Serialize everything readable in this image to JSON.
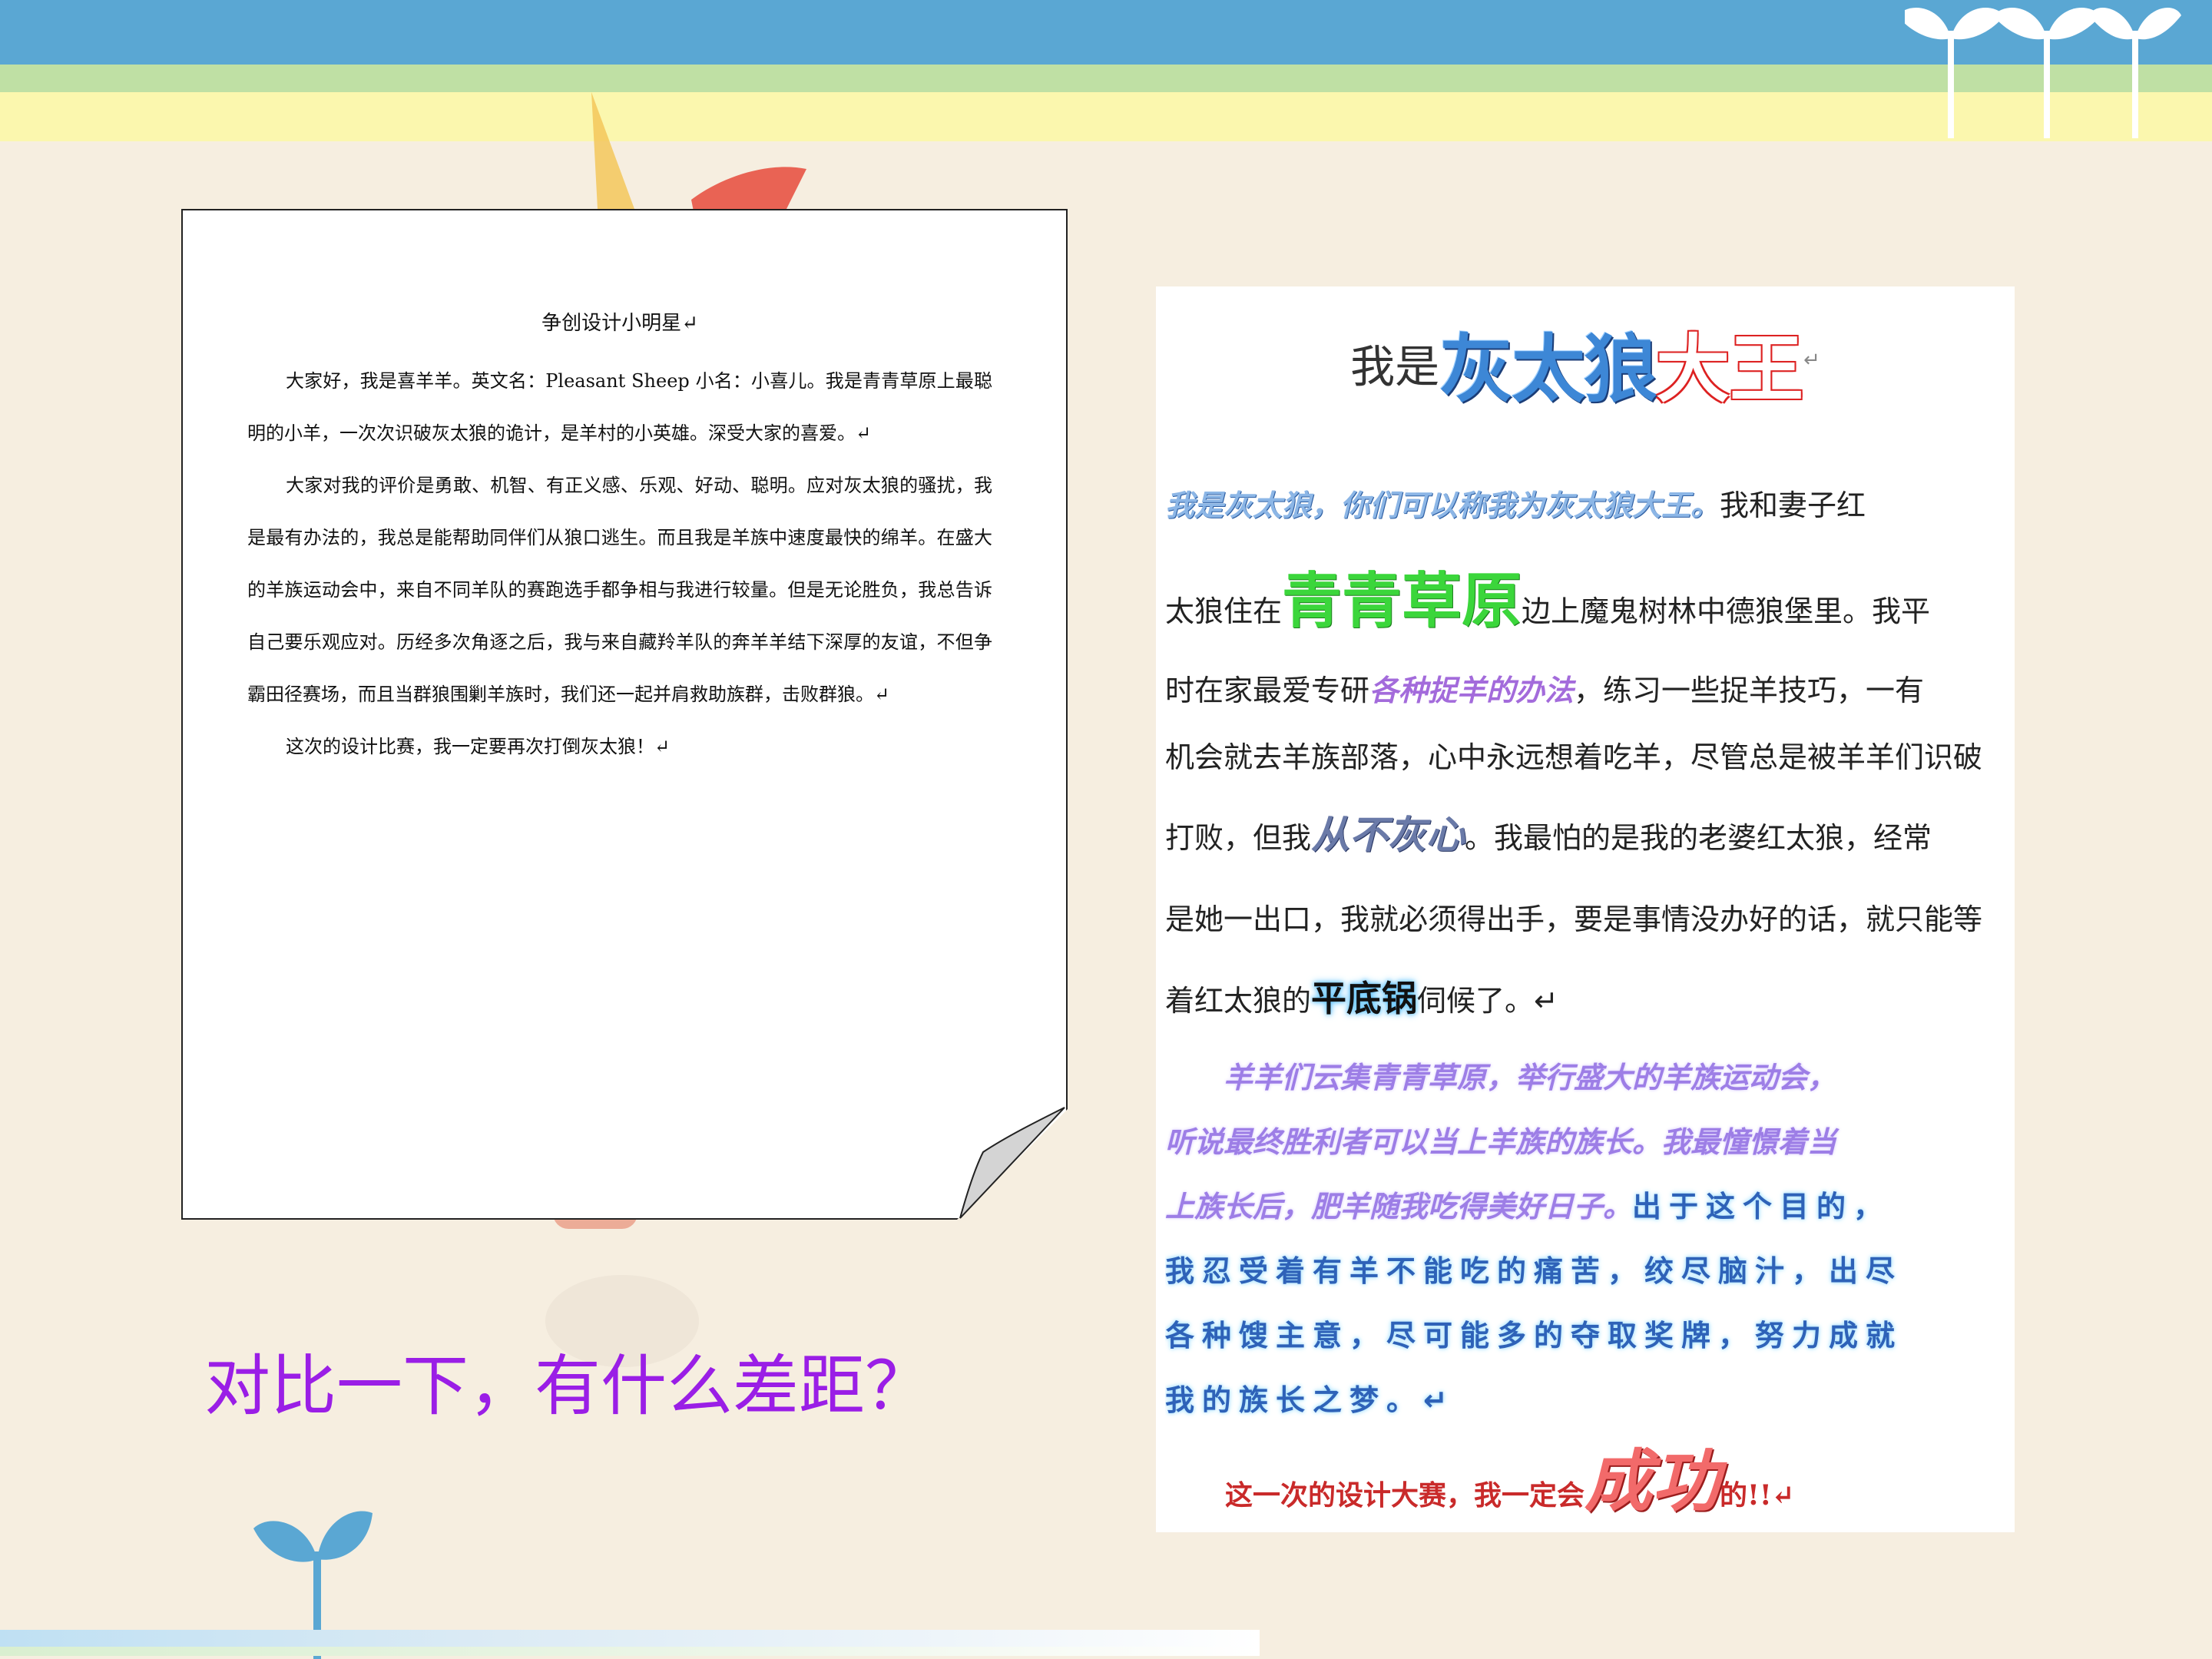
{
  "left_doc": {
    "title": "争创设计小明星↵",
    "paragraphs": [
      "大家好，我是喜羊羊。英文名：Pleasant Sheep 小名：小喜儿。我是青青草原上最聪明的小羊，一次次识破灰太狼的诡计，是羊村的小英雄。深受大家的喜爱。↵",
      "大家对我的评价是勇敢、机智、有正义感、乐观、好动、聪明。应对灰太狼的骚扰，我是最有办法的，我总是能帮助同伴们从狼口逃生。而且我是羊族中速度最快的绵羊。在盛大的羊族运动会中，来自不同羊队的赛跑选手都争相与我进行较量。但是无论胜负，我总告诉自己要乐观应对。历经多次角逐之后，我与来自藏羚羊队的奔羊羊结下深厚的友谊，不但争霸田径赛场，而且当群狼围剿羊族时，我们还一起并肩救助族群，击败群狼。↵",
      "这次的设计比赛，我一定要再次打倒灰太狼！↵"
    ]
  },
  "right_doc": {
    "title_plain": "我是",
    "title_blue": "灰太狼",
    "title_red": "大王",
    "title_mark": "↵",
    "line1_fx": "我是灰太狼，你们可以称我为灰太狼大王。",
    "line1_tail": "我和妻子红",
    "line2_head": "太狼住在",
    "line2_fx": "青青草原",
    "line2_tail": "边上魔鬼树林中德狼堡里。我平",
    "line3_head": "时在家最爱专研",
    "line3_fx": "各种捉羊的办法",
    "line3_tail": "，练习一些捉羊技巧，一有",
    "line4": "机会就去羊族部落，心中永远想着吃羊，尽管总是被羊羊们识破",
    "line5_head": "打败，但我",
    "line5_fx": "从不灰心",
    "line5_tail": "。我最怕的是我的老婆红太狼，经常",
    "line6": "是她一出口，我就必须得出手，要是事情没办好的话，就只能等",
    "line7_head": "着红太狼的",
    "line7_fx": "平底锅",
    "line7_tail": "伺候了。↵",
    "para2": [
      {
        "fx": "　　羊羊们云集青青草原，举行盛大的羊族运动会，",
        "glow": ""
      },
      {
        "fx": "听说最终胜利者可以当上羊族的族长。我最憧憬着当",
        "glow": ""
      },
      {
        "fx": "上族长后，肥羊随我吃得美好日子。",
        "glow": "出于这个目的，"
      },
      {
        "fx": "",
        "glow": "我忍受着有羊不能吃的痛苦，绞尽脑汁，出尽"
      },
      {
        "fx": "",
        "glow": "各种馊主意，尽可能多的夺取奖牌，努力成就"
      },
      {
        "fx": "",
        "glow": "我的族长之梦。↵"
      }
    ],
    "final_head": "这一次的设计大赛，我一定会",
    "final_big": "成功",
    "final_tail": "的!!↵"
  },
  "question": "对比一下，有什么差距？",
  "colors": {
    "accent_purple": "#9a1ee6",
    "band_blue": "#5aa7d3",
    "band_green": "#bfe0a4",
    "band_yellow": "#fbf7ae"
  }
}
